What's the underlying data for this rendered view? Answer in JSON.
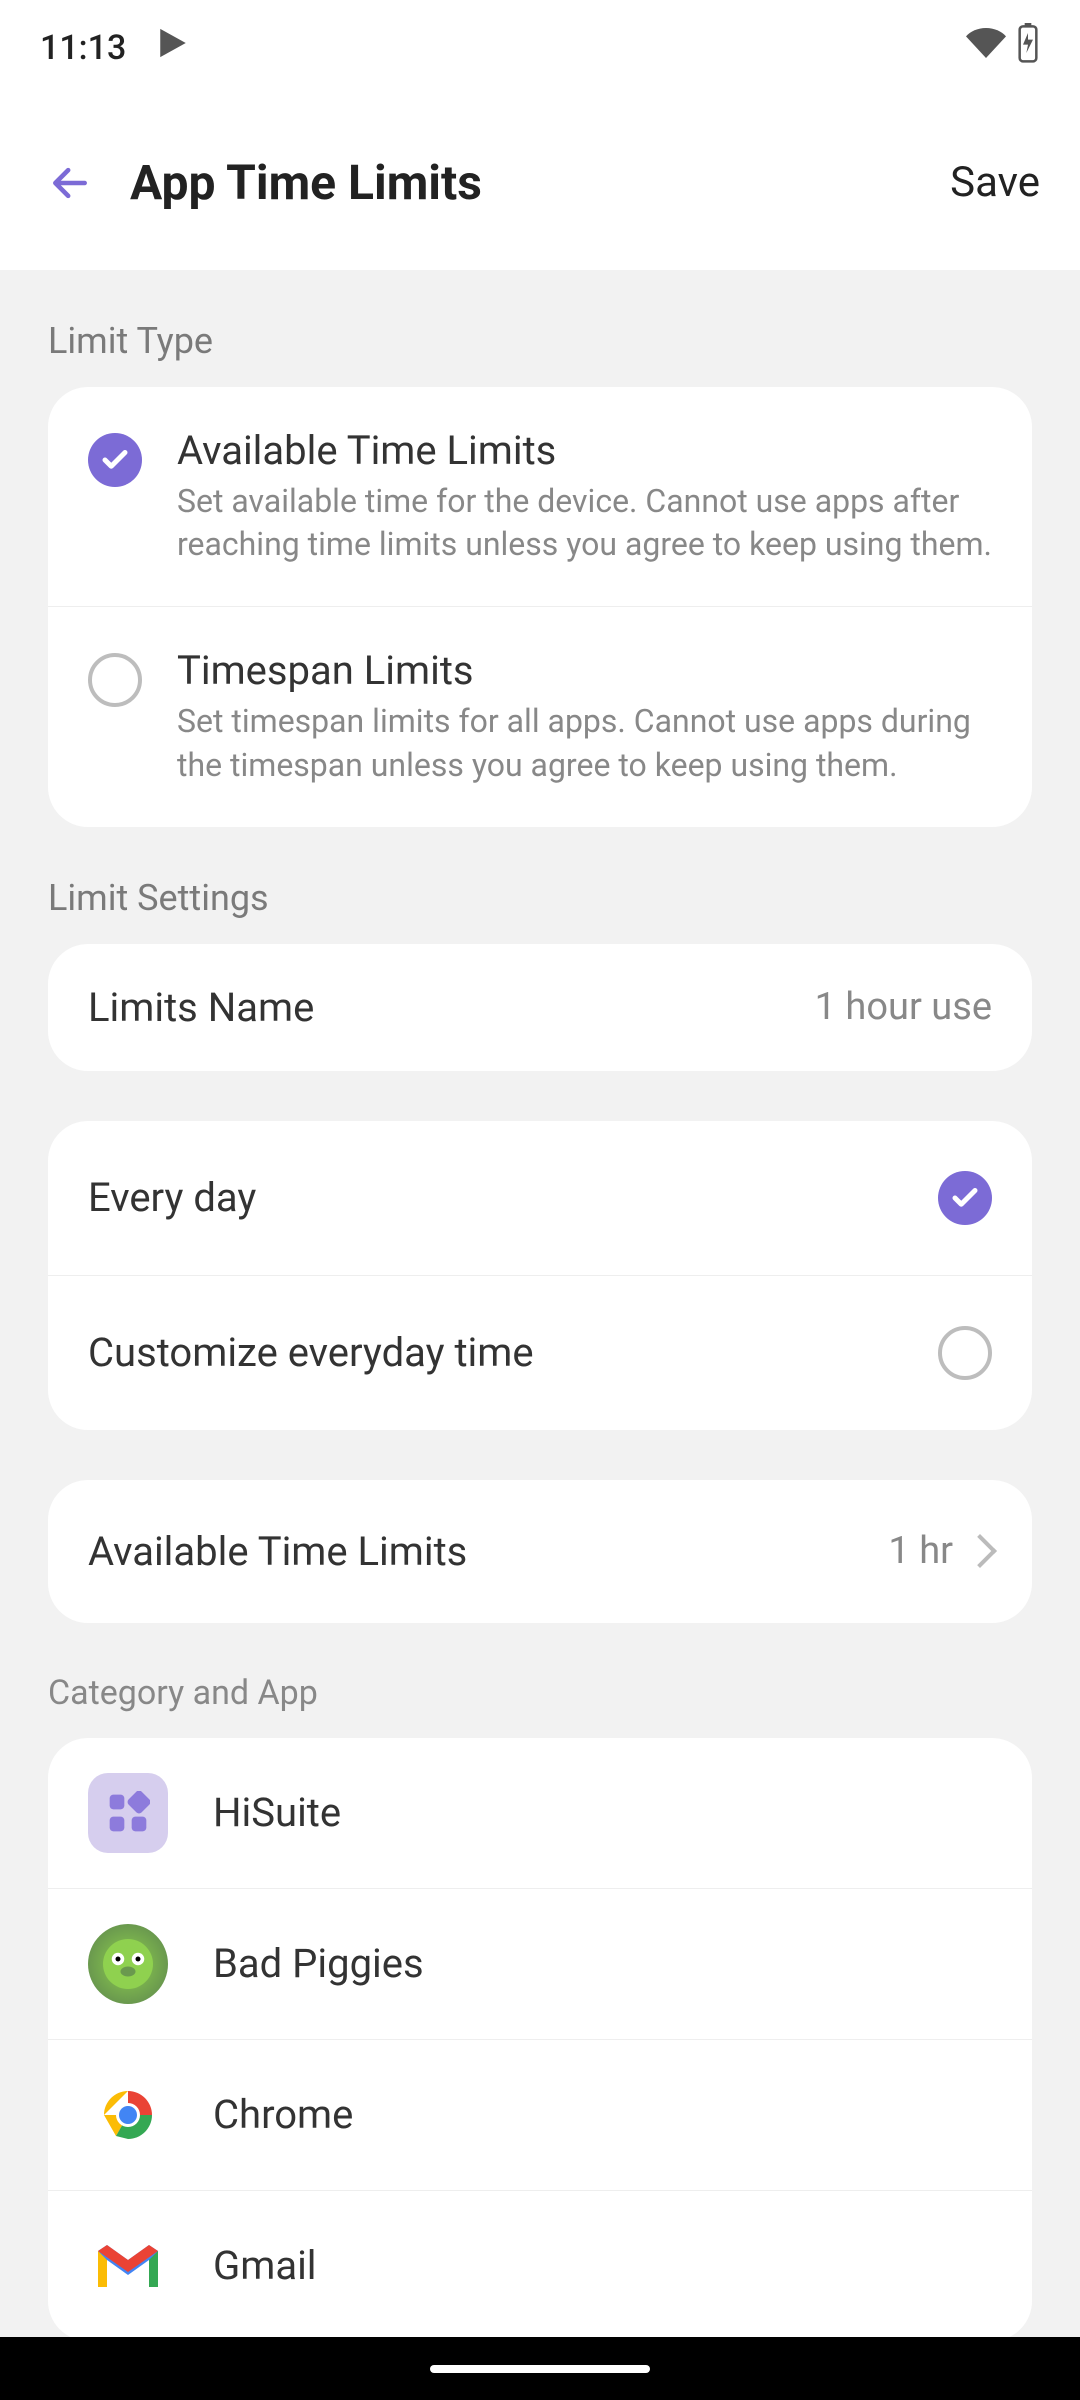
{
  "status": {
    "time": "11:13"
  },
  "header": {
    "title": "App Time Limits",
    "save": "Save"
  },
  "section_limit_type": "Limit Type",
  "limit_types": [
    {
      "title": "Available Time Limits",
      "desc": "Set available time for the device. Cannot use apps after reaching time limits unless you agree to keep using them.",
      "selected": true
    },
    {
      "title": "Timespan Limits",
      "desc": "Set timespan limits for all apps. Cannot use apps during the timespan unless you agree to keep using them.",
      "selected": false
    }
  ],
  "section_limit_settings": "Limit Settings",
  "limits_name": {
    "label": "Limits Name",
    "value": "1 hour use"
  },
  "schedule": [
    {
      "label": "Every day",
      "checked": true
    },
    {
      "label": "Customize everyday time",
      "checked": false
    }
  ],
  "available_limit": {
    "label": "Available Time Limits",
    "value": "1 hr"
  },
  "section_category": "Category and App",
  "apps": [
    {
      "name": "HiSuite",
      "icon": "hisuite"
    },
    {
      "name": "Bad Piggies",
      "icon": "badpiggies"
    },
    {
      "name": "Chrome",
      "icon": "chrome"
    },
    {
      "name": "Gmail",
      "icon": "gmail"
    }
  ]
}
